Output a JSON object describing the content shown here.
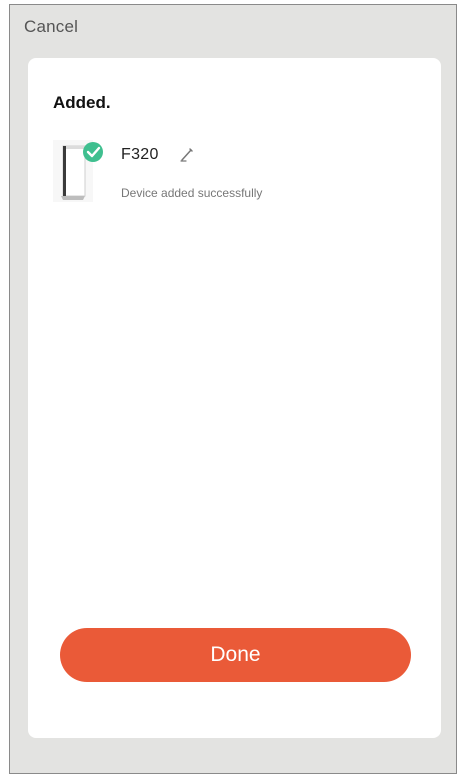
{
  "header": {
    "cancel_label": "Cancel"
  },
  "card": {
    "title": "Added.",
    "device": {
      "name": "F320",
      "status": "Device added successfully",
      "thumbnail_icon": "air-purifier-icon",
      "badge_icon": "check-circle-icon",
      "edit_icon": "pencil-icon"
    }
  },
  "actions": {
    "done_label": "Done"
  },
  "colors": {
    "accent": "#ea5a38",
    "success": "#3fbf8f",
    "background": "#e3e3e1",
    "card": "#ffffff"
  }
}
